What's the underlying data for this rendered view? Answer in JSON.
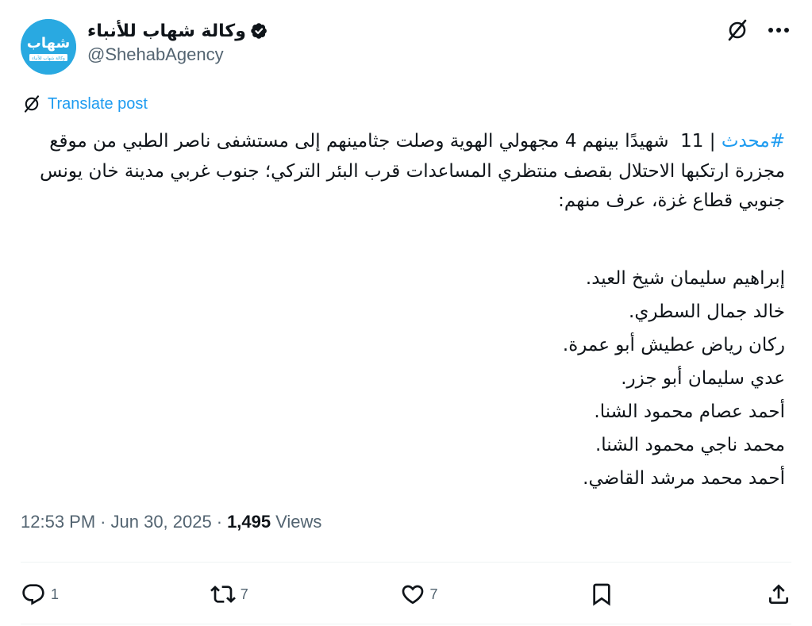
{
  "account": {
    "name": "وكالة شهاب للأنباء",
    "handle": "@ShehabAgency",
    "avatar_text": "شهاب",
    "avatar_subtext": "وكالة شهاب للأنباء",
    "avatar_color": "#29a9e1"
  },
  "translate_label": "Translate post",
  "post": {
    "hashtag": "#محدث",
    "text": " | 11  شهيدًا بينهم 4 مجهولي الهوية وصلت جثامينهم إلى مستشفى ناصر الطبي من موقع مجزرة ارتكبها الاحتلال بقصف منتظري المساعدات قرب البئر التركي؛ جنوب غربي مدينة خان يونس جنوبي قطاع غزة، عرف منهم:",
    "names": [
      ".إبراهيم سليمان شيخ العيد",
      ".خالد جمال السطري",
      ".ركان رياض عطيش أبو عمرة",
      ".عدي سليمان أبو جزر",
      ".أحمد عصام محمود الشنا",
      ".محمد ناجي محمود الشنا",
      ".أحمد محمد مرشد القاضي"
    ]
  },
  "meta": {
    "time": "12:53 PM",
    "sep": "·",
    "date": "Jun 30, 2025",
    "sep2": "·",
    "views_count": "1,495",
    "views_label": "Views"
  },
  "actions": {
    "replies": "1",
    "reposts": "7",
    "likes": "7"
  },
  "colors": {
    "accent": "#1d9bf0",
    "muted": "#536471",
    "text": "#0f1419"
  }
}
